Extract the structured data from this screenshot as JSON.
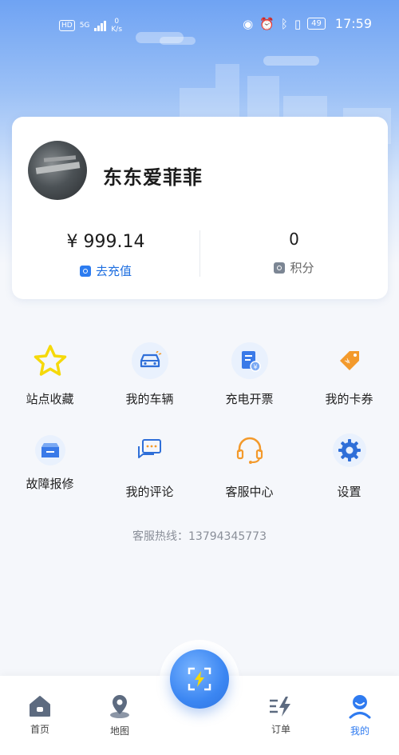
{
  "status_bar": {
    "hd": "HD",
    "net": "5G",
    "speed_value": "0",
    "speed_unit": "K/s",
    "battery": "49",
    "time": "17:59"
  },
  "profile": {
    "username": "东东爱菲菲",
    "balance": "¥ 999.14",
    "recharge_label": "去充值",
    "points_value": "0",
    "points_label": "积分"
  },
  "menu": [
    {
      "label": "站点收藏",
      "icon": "star-icon"
    },
    {
      "label": "我的车辆",
      "icon": "car-icon"
    },
    {
      "label": "充电开票",
      "icon": "invoice-icon"
    },
    {
      "label": "我的卡券",
      "icon": "coupon-icon"
    },
    {
      "label": "故障报修",
      "icon": "repair-icon"
    },
    {
      "label": "我的评论",
      "icon": "comment-icon"
    },
    {
      "label": "客服中心",
      "icon": "headset-icon"
    },
    {
      "label": "设置",
      "icon": "gear-icon"
    }
  ],
  "hotline": "客服热线：13794345773",
  "tabbar": {
    "home": "首页",
    "map": "地图",
    "orders": "订单",
    "mine": "我的"
  },
  "colors": {
    "accent": "#2f7bf0",
    "star": "#f5d90a",
    "orange": "#f39a2c"
  }
}
